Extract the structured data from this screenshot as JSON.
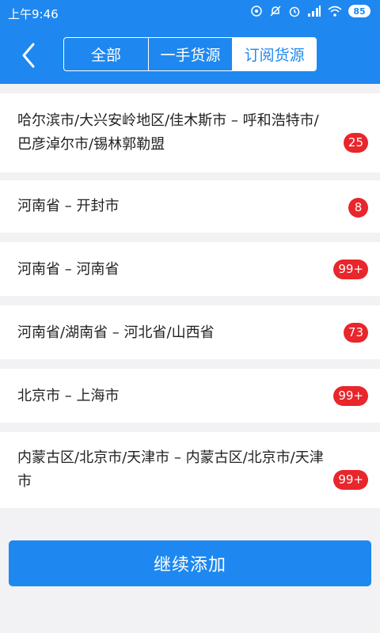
{
  "status_bar": {
    "time": "上午9:46",
    "battery": "85"
  },
  "header": {
    "tabs": [
      {
        "label": "全部",
        "active": false
      },
      {
        "label": "一手货源",
        "active": false
      },
      {
        "label": "订阅货源",
        "active": true
      }
    ]
  },
  "subscriptions": [
    {
      "route": "哈尔滨市/大兴安岭地区/佳木斯市 – 呼和浩特市/巴彦淖尔市/锡林郭勒盟",
      "count": "25"
    },
    {
      "route": "河南省 – 开封市",
      "count": "8"
    },
    {
      "route": "河南省 – 河南省",
      "count": "99+"
    },
    {
      "route": "河南省/湖南省 – 河北省/山西省",
      "count": "73"
    },
    {
      "route": "北京市 – 上海市",
      "count": "99+"
    },
    {
      "route": "内蒙古区/北京市/天津市 – 内蒙古区/北京市/天津市",
      "count": "99+"
    }
  ],
  "footer": {
    "add_button_label": "继续添加"
  },
  "colors": {
    "primary": "#1e88f0",
    "badge": "#e8262b",
    "background": "#f2f2f4"
  }
}
